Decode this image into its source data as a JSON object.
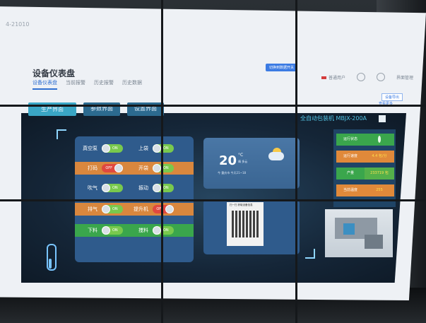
{
  "window": {
    "tag": "4-21010"
  },
  "header": {
    "title": "设备仪表盘",
    "tabs": [
      {
        "label": "设备仪表盘",
        "active": true
      },
      {
        "label": "当前报警"
      },
      {
        "label": "历史报警"
      },
      {
        "label": "历史数据"
      }
    ],
    "top_chip": "切换到数据开关",
    "top_right": [
      "普通用户",
      "",
      "",
      "界面管理"
    ],
    "export_button": "设备导出",
    "more_link": "查看更多"
  },
  "dashboard": {
    "tabs": [
      "生产界面",
      "参数界面",
      "设置界面"
    ],
    "model": "全自动包装机  MBJX-200A",
    "switches": [
      {
        "left": {
          "label": "真空泵",
          "state": "ON"
        },
        "right": {
          "label": "上袋",
          "state": "ON"
        }
      },
      {
        "left": {
          "label": "打码",
          "state": "OFF"
        },
        "right": {
          "label": "开袋",
          "state": "ON"
        }
      },
      {
        "left": {
          "label": "吹气",
          "state": "ON"
        },
        "right": {
          "label": "振动",
          "state": "ON"
        }
      },
      {
        "left": {
          "label": "排气",
          "state": "ON"
        },
        "right": {
          "label": "提升机",
          "state": "OFF"
        }
      },
      {
        "left": {
          "label": "下料",
          "state": "ON"
        },
        "right": {
          "label": "搅料",
          "state": "ON"
        }
      }
    ],
    "weather": {
      "temp": "20",
      "unit": "°C",
      "desc": "晴 多云",
      "location": "今 重庆市  今天21~18"
    },
    "qr": {
      "title": "扫一扫 获取设备信息"
    },
    "side": {
      "rows": [
        {
          "label": "运行状态",
          "value": ""
        },
        {
          "label": "运行速度",
          "value": "4.4 包/分"
        },
        {
          "label": "产量",
          "value": "233719 包"
        },
        {
          "label": "当前温度",
          "value": "255"
        }
      ]
    }
  },
  "colors": {
    "on": "#79c94d",
    "off": "#e0483f",
    "accent": "#3aa6c5"
  }
}
